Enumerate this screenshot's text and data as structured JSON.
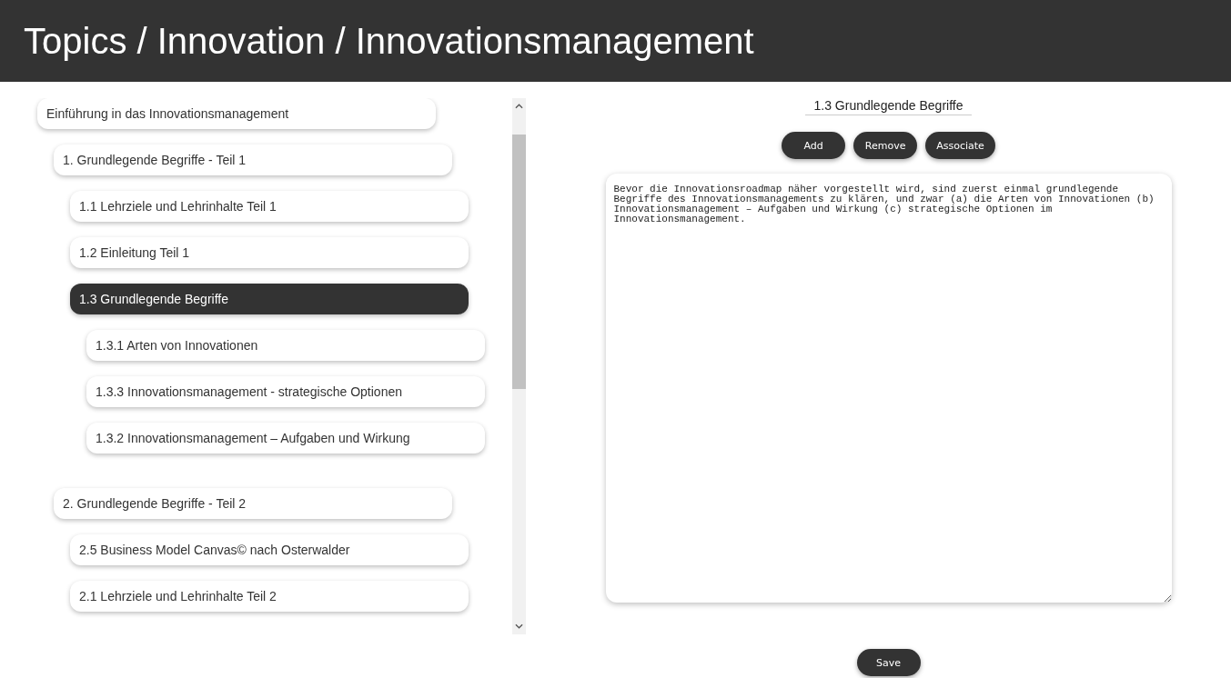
{
  "header": {
    "breadcrumb": "Topics / Innovation / Innovationsmanagement"
  },
  "tree": [
    {
      "label": "Einführung in das Innovationsmanagement",
      "selected": false,
      "children": [
        {
          "label": "1. Grundlegende Begriffe - Teil 1",
          "selected": false,
          "children": [
            {
              "label": "1.1 Lehrziele und Lehrinhalte Teil 1",
              "selected": false
            },
            {
              "label": "1.2 Einleitung Teil 1",
              "selected": false
            },
            {
              "label": "1.3 Grundlegende Begriffe",
              "selected": true,
              "children": [
                {
                  "label": "1.3.1 Arten von Innovationen",
                  "selected": false
                },
                {
                  "label": "1.3.3 Innovationsmanagement - strategische Optionen",
                  "selected": false
                },
                {
                  "label": "1.3.2 Innovationsmanagement – Aufgaben und Wirkung",
                  "selected": false
                }
              ]
            }
          ]
        },
        {
          "label": "2. Grundlegende Begriffe - Teil 2",
          "selected": false,
          "children": [
            {
              "label": "2.5 Business Model Canvas© nach Osterwalder",
              "selected": false
            },
            {
              "label": "2.1 Lehrziele und Lehrinhalte Teil 2",
              "selected": false
            }
          ]
        }
      ]
    }
  ],
  "editor": {
    "title": "1.3 Grundlegende Begriffe",
    "buttons": [
      "Add",
      "Remove",
      "Associate"
    ],
    "content": "Bevor die Innovationsroadmap näher vorgestellt wird, sind zuerst einmal grundlegende Begriffe des Innovationsmanagements zu klären, und zwar (a) die Arten von Innovationen (b) Innovationsmanagement – Aufgaben und Wirkung (c) strategische Optionen im Innovationsmanagement.",
    "save": "Save"
  }
}
